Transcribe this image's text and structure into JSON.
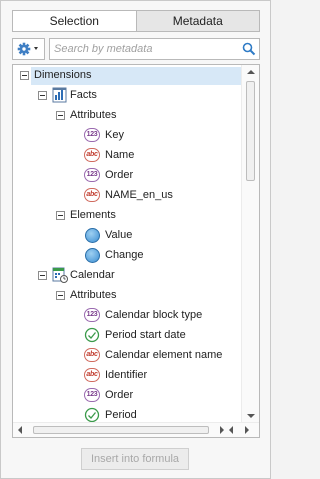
{
  "tabs": [
    {
      "label": "Selection",
      "active": true
    },
    {
      "label": "Metadata",
      "active": false
    }
  ],
  "toolbar": {
    "settings_icon": "gear-icon",
    "search_placeholder": "Search by metadata",
    "search_icon": "search-icon"
  },
  "tree": {
    "root": "Dimensions",
    "facts": {
      "label": "Facts",
      "attributes_label": "Attributes",
      "attributes": [
        {
          "label": "Key",
          "type": "123"
        },
        {
          "label": "Name",
          "type": "abc"
        },
        {
          "label": "Order",
          "type": "123"
        },
        {
          "label": "NAME_en_us",
          "type": "abc"
        }
      ],
      "elements_label": "Elements",
      "elements": [
        {
          "label": "Value"
        },
        {
          "label": "Change"
        }
      ]
    },
    "calendar": {
      "label": "Calendar",
      "attributes_label": "Attributes",
      "attributes": [
        {
          "label": "Calendar block type",
          "type": "123"
        },
        {
          "label": "Period start date",
          "type": "date"
        },
        {
          "label": "Calendar element name",
          "type": "abc"
        },
        {
          "label": "Identifier",
          "type": "abc"
        },
        {
          "label": "Order",
          "type": "123"
        },
        {
          "label": "Period",
          "type": "date"
        }
      ]
    }
  },
  "badges": {
    "num": "123",
    "abc": "abc"
  },
  "footer": {
    "insert_label": "Insert into formula"
  },
  "colors": {
    "selected_row": "#d7e8f7",
    "number_badge": "#7a3c8c",
    "text_badge": "#c0392b",
    "element_ball": "#3e8fd2"
  }
}
